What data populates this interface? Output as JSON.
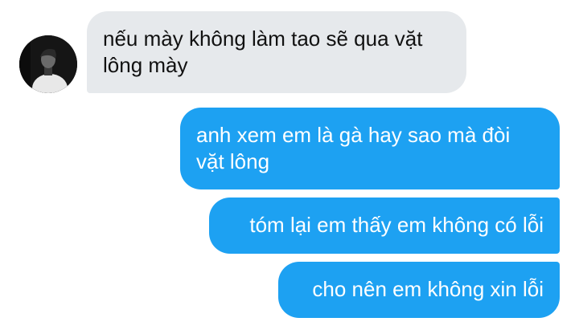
{
  "conversation": {
    "contact": {
      "avatar_icon": "profile-photo"
    },
    "messages": [
      {
        "direction": "incoming",
        "text": "nếu mày không làm tao sẽ qua vặt lông mày"
      },
      {
        "direction": "outgoing",
        "text": "anh xem em là gà hay sao mà đòi vặt lông"
      },
      {
        "direction": "outgoing",
        "text": "tóm lại em thấy em không có lỗi"
      },
      {
        "direction": "outgoing",
        "text": "cho nên em không xin lỗi"
      }
    ],
    "colors": {
      "incoming_bubble": "#e6e9ec",
      "outgoing_bubble": "#1da1f2",
      "incoming_text": "#111111",
      "outgoing_text": "#ffffff"
    }
  }
}
